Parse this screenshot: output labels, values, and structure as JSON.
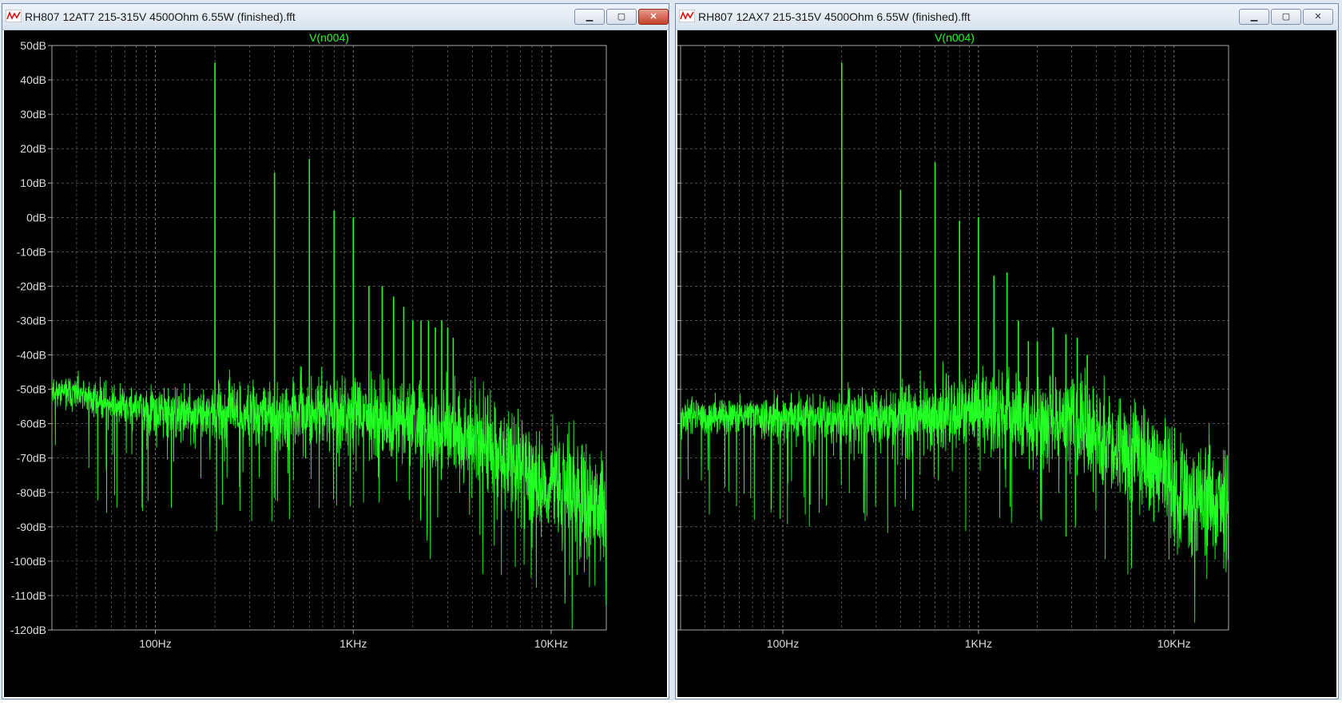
{
  "colors": {
    "trace": "#22ff22",
    "background": "#000000",
    "axis": "#aaaaaa",
    "label_color": "#dddddd"
  },
  "window_buttons": {
    "minimize": "▁",
    "maximize": "▢",
    "close": "✕"
  },
  "windows": [
    {
      "title": "RH807 12AT7 215-315V 4500Ohm 6.55W (finished).fft",
      "active": true,
      "trace_label": "V(n004)",
      "chart_data": {
        "type": "line",
        "y_scale": "linear",
        "x_scale": "log",
        "ylim": [
          -120,
          50
        ],
        "xlim_hz": [
          30,
          19000
        ],
        "y_ticks": [
          50,
          40,
          30,
          20,
          10,
          0,
          -10,
          -20,
          -30,
          -40,
          -50,
          -60,
          -70,
          -80,
          -90,
          -100,
          -110,
          -120
        ],
        "y_tick_labels": [
          "50dB",
          "40dB",
          "30dB",
          "20dB",
          "10dB",
          "0dB",
          "-10dB",
          "-20dB",
          "-30dB",
          "-40dB",
          "-50dB",
          "-60dB",
          "-70dB",
          "-80dB",
          "-90dB",
          "-100dB",
          "-110dB",
          "-120dB"
        ],
        "x_ticks": [
          100,
          1000,
          10000
        ],
        "x_tick_labels": [
          "100Hz",
          "1KHz",
          "10KHz"
        ],
        "grid": true,
        "series": [
          {
            "name": "V(n004)",
            "harmonics": [
              {
                "x": 200,
                "y": 45
              },
              {
                "x": 400,
                "y": 13
              },
              {
                "x": 600,
                "y": 17
              },
              {
                "x": 800,
                "y": 2
              },
              {
                "x": 1000,
                "y": 0
              },
              {
                "x": 1200,
                "y": -20
              },
              {
                "x": 1400,
                "y": -20
              },
              {
                "x": 1600,
                "y": -23
              },
              {
                "x": 1800,
                "y": -26
              },
              {
                "x": 2000,
                "y": -30
              },
              {
                "x": 2200,
                "y": -30
              },
              {
                "x": 2400,
                "y": -30
              },
              {
                "x": 2600,
                "y": -32
              },
              {
                "x": 2800,
                "y": -30
              },
              {
                "x": 3000,
                "y": -32
              },
              {
                "x": 3200,
                "y": -35
              }
            ],
            "noise_floor": [
              {
                "x": 30,
                "y": -50
              },
              {
                "x": 100,
                "y": -57
              },
              {
                "x": 300,
                "y": -57
              },
              {
                "x": 1000,
                "y": -57
              },
              {
                "x": 3000,
                "y": -62
              },
              {
                "x": 6000,
                "y": -70
              },
              {
                "x": 10000,
                "y": -78
              },
              {
                "x": 19000,
                "y": -85
              }
            ]
          }
        ]
      }
    },
    {
      "title": "RH807 12AX7 215-315V 4500Ohm 6.55W (finished).fft",
      "active": false,
      "trace_label": "V(n004)",
      "chart_data": {
        "type": "line",
        "y_scale": "linear",
        "x_scale": "log",
        "ylim": [
          -120,
          50
        ],
        "xlim_hz": [
          30,
          19000
        ],
        "y_ticks": [
          50,
          40,
          30,
          20,
          10,
          0,
          -10,
          -20,
          -30,
          -40,
          -50,
          -60,
          -70,
          -80,
          -90,
          -100,
          -110,
          -120
        ],
        "y_tick_labels": [
          "50dB",
          "40dB",
          "30dB",
          "20dB",
          "10dB",
          "0dB",
          "-10dB",
          "-20dB",
          "-30dB",
          "-40dB",
          "-50dB",
          "-60dB",
          "-70dB",
          "-80dB",
          "-90dB",
          "-100dB",
          "-110dB",
          "-120dB"
        ],
        "x_ticks": [
          100,
          1000,
          10000
        ],
        "x_tick_labels": [
          "100Hz",
          "1KHz",
          "10KHz"
        ],
        "grid": true,
        "series": [
          {
            "name": "V(n004)",
            "harmonics": [
              {
                "x": 200,
                "y": 45
              },
              {
                "x": 400,
                "y": 8
              },
              {
                "x": 600,
                "y": 16
              },
              {
                "x": 800,
                "y": -1
              },
              {
                "x": 1000,
                "y": 0
              },
              {
                "x": 1200,
                "y": -17
              },
              {
                "x": 1400,
                "y": -16
              },
              {
                "x": 1600,
                "y": -30
              },
              {
                "x": 1800,
                "y": -36
              },
              {
                "x": 2000,
                "y": -36
              },
              {
                "x": 2400,
                "y": -32
              },
              {
                "x": 2800,
                "y": -34
              },
              {
                "x": 3200,
                "y": -35
              },
              {
                "x": 3600,
                "y": -40
              }
            ],
            "noise_floor": [
              {
                "x": 30,
                "y": -58
              },
              {
                "x": 100,
                "y": -58
              },
              {
                "x": 300,
                "y": -58
              },
              {
                "x": 1000,
                "y": -57
              },
              {
                "x": 3000,
                "y": -60
              },
              {
                "x": 6000,
                "y": -68
              },
              {
                "x": 10000,
                "y": -78
              },
              {
                "x": 19000,
                "y": -85
              }
            ]
          }
        ]
      }
    }
  ]
}
